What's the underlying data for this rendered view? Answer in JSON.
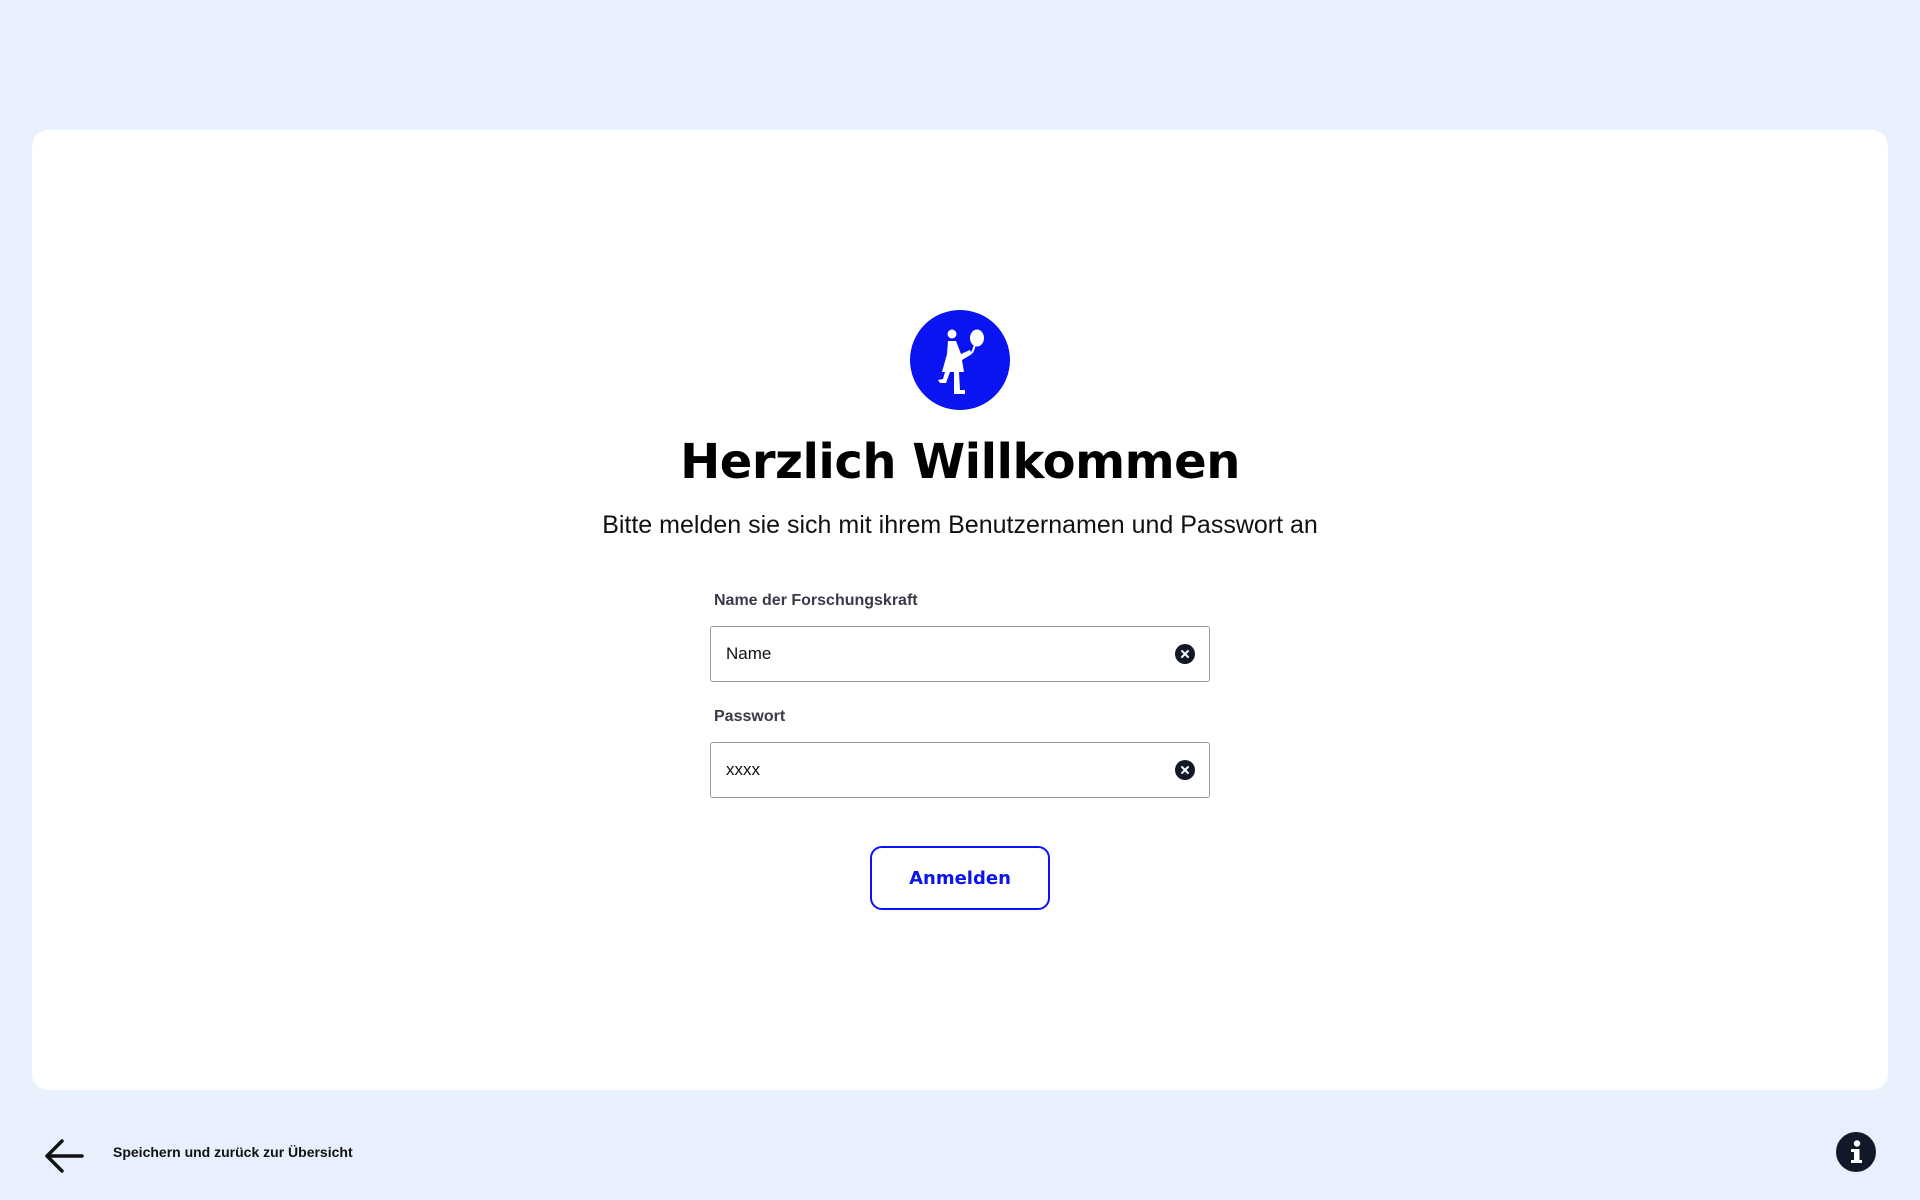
{
  "brand": {
    "logo_icon": "child-with-balloon-icon",
    "accent_color": "#0a14f0"
  },
  "login": {
    "title": "Herzlich Willkommen",
    "subtitle": "Bitte melden sie sich mit ihrem Benutzernamen und Passwort an",
    "name_field": {
      "label": "Name der Forschungskraft",
      "value": "Name",
      "clear_icon": "clear-circle-icon"
    },
    "password_field": {
      "label": "Passwort",
      "value": "xxxx",
      "clear_icon": "clear-circle-icon"
    },
    "submit_label": "Anmelden"
  },
  "footer": {
    "back_icon": "arrow-left-icon",
    "back_label": "Speichern und zurück zur Übersicht",
    "info_icon": "info-icon"
  }
}
